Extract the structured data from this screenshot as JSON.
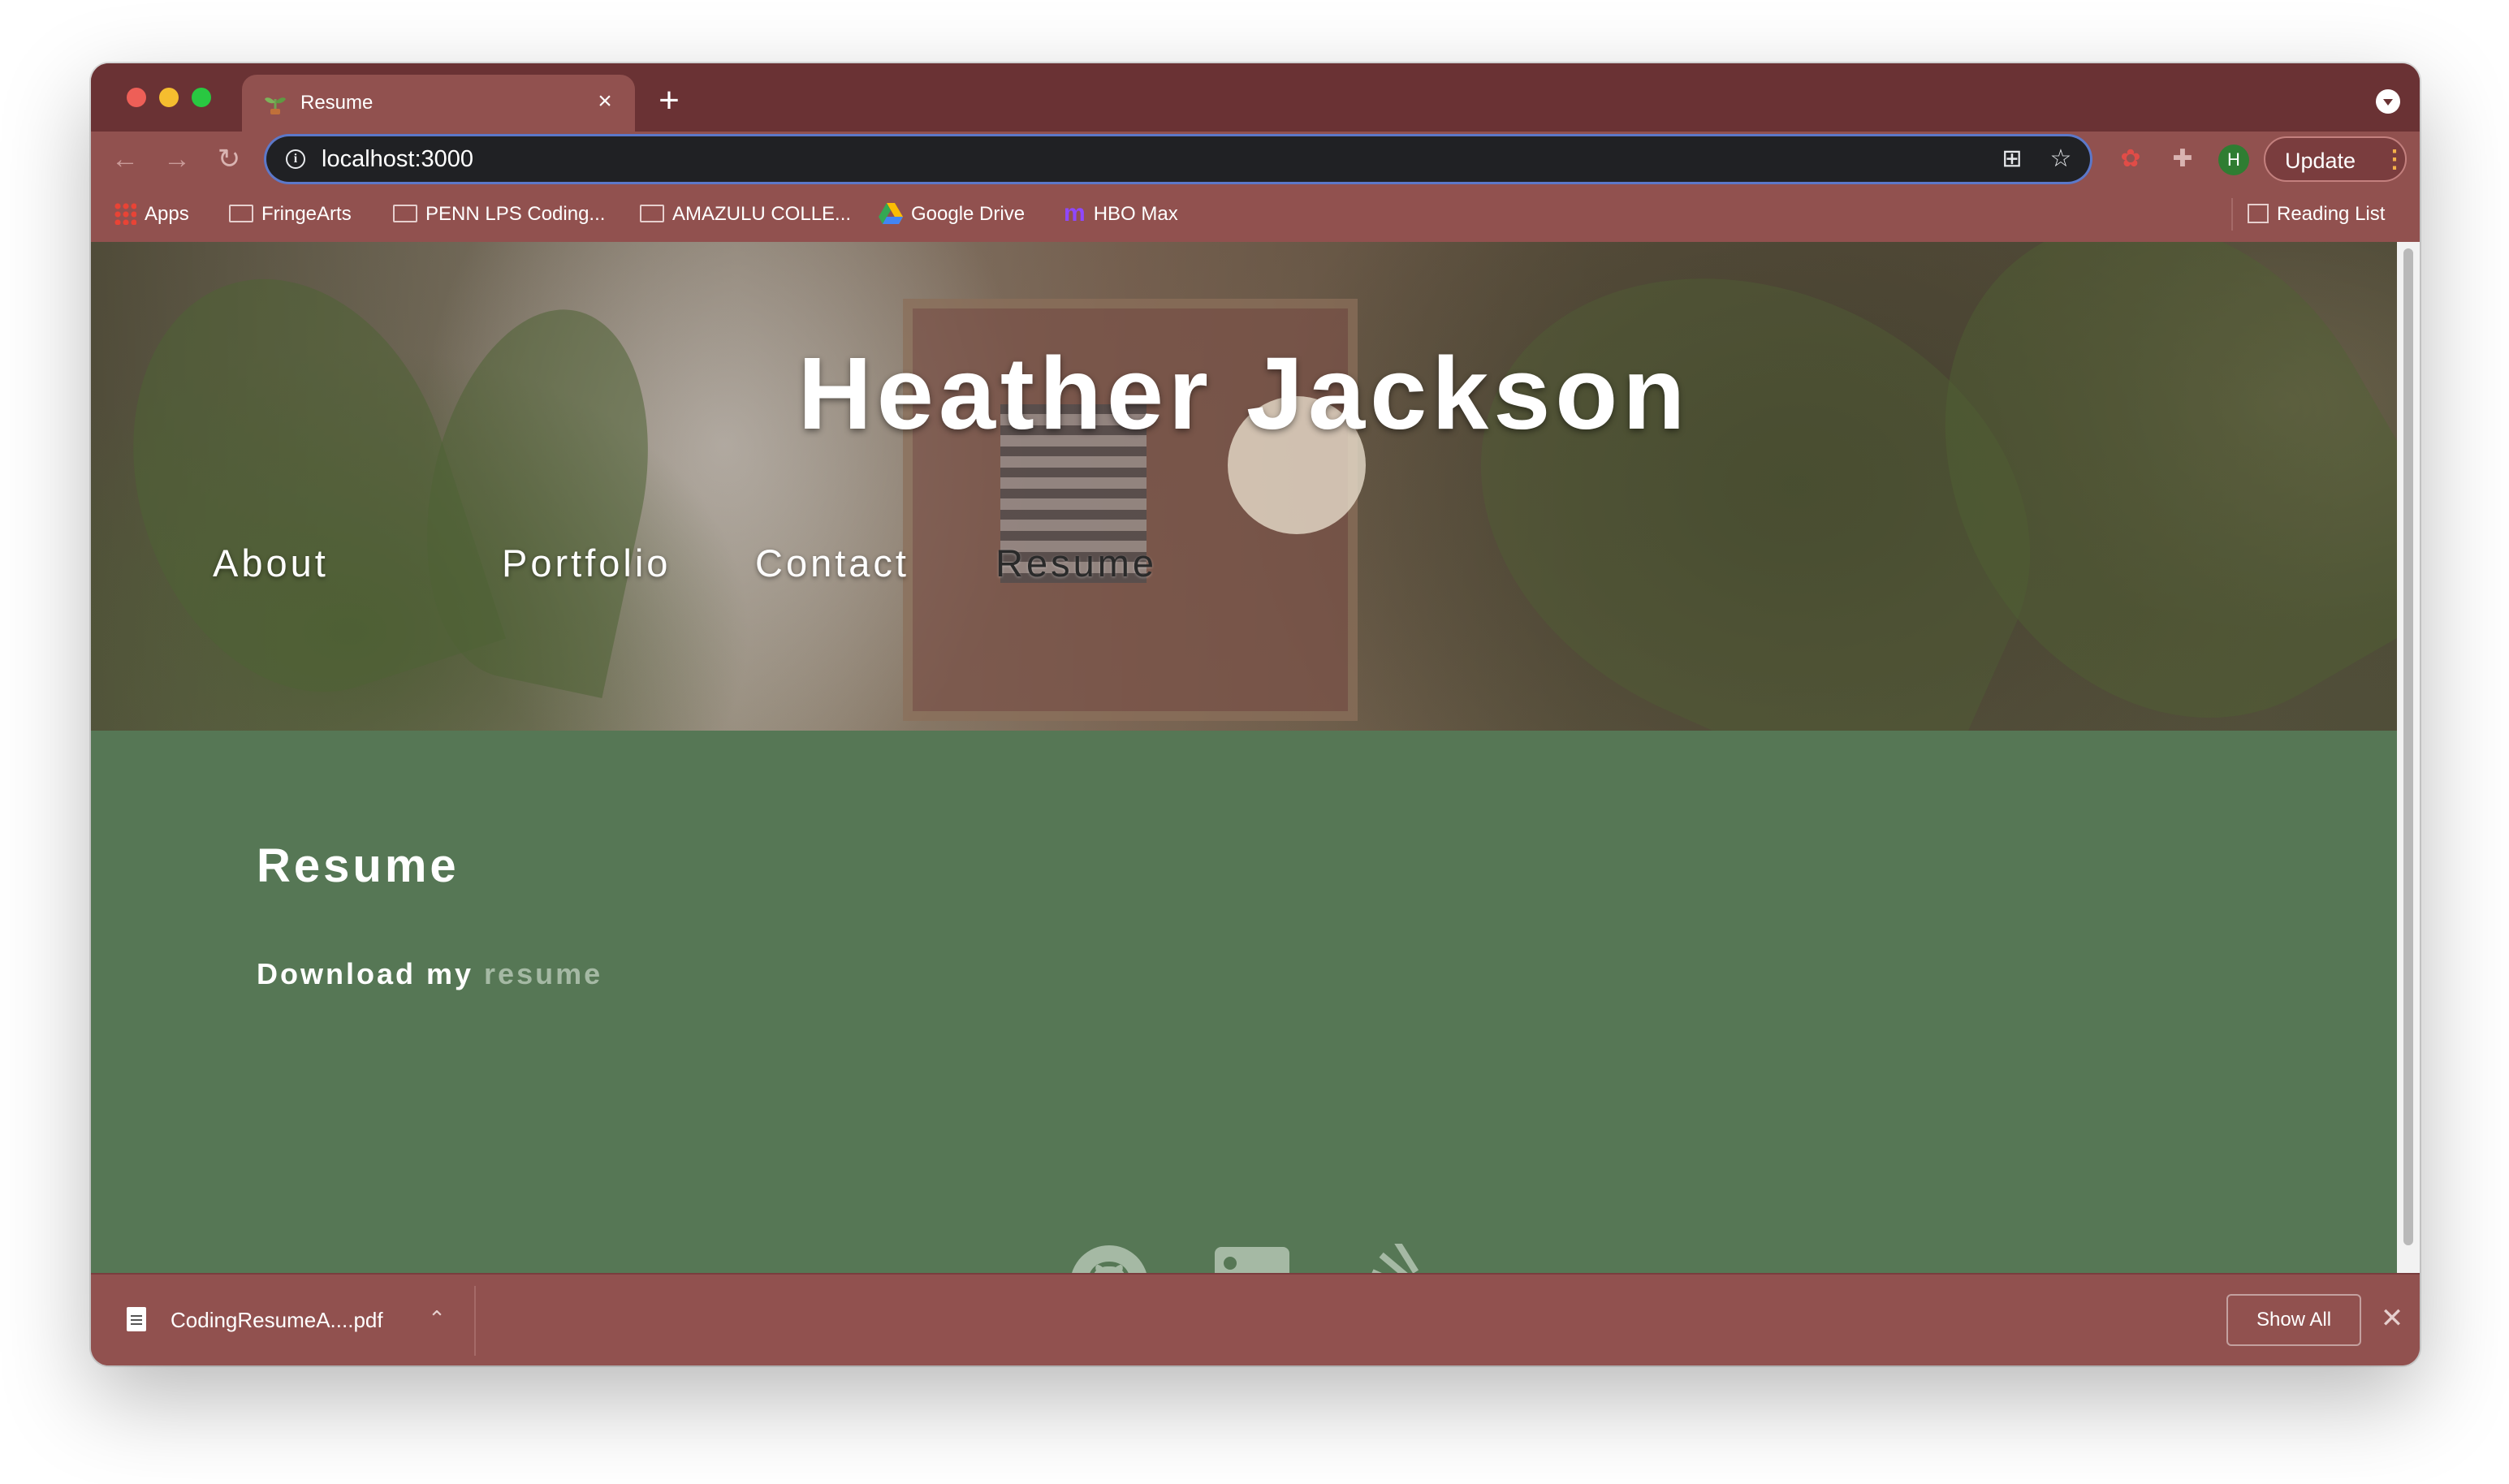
{
  "browser": {
    "tab": {
      "title": "Resume",
      "close_glyph": "×",
      "favicon": "plant-favicon-icon"
    },
    "new_tab_glyph": "+",
    "toolbar": {
      "back_glyph": "←",
      "forward_glyph": "→",
      "reload_glyph": "↻",
      "url": "localhost:3000",
      "info_glyph": "i",
      "qr_glyph": "⊞",
      "star_glyph": "☆",
      "extension_glyph": "✿",
      "puzzle_glyph": "✚",
      "profile_initial": "H",
      "update_label": "Update",
      "update_dots": "⋮"
    },
    "bookmarks": [
      {
        "label": "Apps",
        "icon": "apps-grid-icon"
      },
      {
        "label": "FringeArts",
        "icon": "folder-icon"
      },
      {
        "label": "PENN LPS Coding...",
        "icon": "folder-icon"
      },
      {
        "label": "AMAZULU COLLE...",
        "icon": "folder-icon"
      },
      {
        "label": "Google Drive",
        "icon": "google-drive-icon"
      },
      {
        "label": "HBO Max",
        "icon": "hbo-max-icon"
      }
    ],
    "reading_list": "Reading List",
    "colors": {
      "tab_strip": "#6a3234",
      "toolbar": "#91514f",
      "page_bg": "#567755"
    }
  },
  "page": {
    "name": "Heather Jackson",
    "nav": [
      "About",
      "Portfolio",
      "Contact",
      "Resume"
    ],
    "active_nav": "Resume",
    "section_title": "Resume",
    "download_prefix": "Download my",
    "download_link": "resume",
    "social": [
      "github-icon",
      "linkedin-icon",
      "stackoverflow-icon"
    ]
  },
  "downloads": {
    "file_name": "CodingResumeA....pdf",
    "chevron_glyph": "⌃",
    "show_all": "Show All",
    "close_glyph": "✕"
  }
}
